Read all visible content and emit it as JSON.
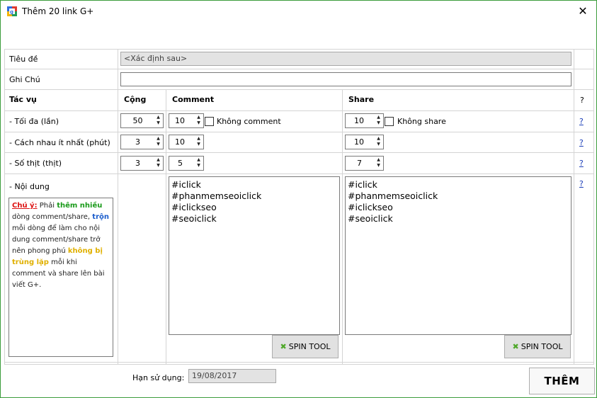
{
  "window": {
    "title": "Thêm 20 link G+",
    "close_glyph": "✕"
  },
  "rows": {
    "tieu_de": {
      "label": "Tiêu đề",
      "value": "<Xác định sau>"
    },
    "ghi_chu": {
      "label": "Ghi Chú",
      "value": ""
    }
  },
  "headers": {
    "tac_vu": "Tác vụ",
    "cong": "Cộng",
    "comment": "Comment",
    "share": "Share",
    "help": "?"
  },
  "toi_da": {
    "label": " - Tối đa (lần)",
    "cong": "50",
    "comment": "10",
    "comment_check": "Không comment",
    "share": "10",
    "share_check": "Không share",
    "help": "?"
  },
  "cach_nhau": {
    "label": " - Cách nhau ít nhất (phút)",
    "cong": "3",
    "comment": "10",
    "share": "10",
    "help": "?"
  },
  "so_thit": {
    "label": " - Số thịt (thịt)",
    "cong": "3",
    "comment": "5",
    "share": "7",
    "help": "?"
  },
  "noi_dung": {
    "label": " - Nội dung",
    "help": "?",
    "comment_lines": [
      "#iclick",
      "#phanmemseoiclick",
      "#iclickseo",
      "#seoiclick"
    ],
    "share_lines": [
      "#iclick",
      "#phanmemseoiclick",
      "#iclickseo",
      "#seoiclick"
    ]
  },
  "note": {
    "chu_y": "Chú ý:",
    "t1": " Phải ",
    "them_nhieu": "thêm nhiều",
    "t2": " dòng comment/share, ",
    "tron": "trộn",
    "t3": " mỗi dòng để làm cho nội dung comment/share trở nên phong phú ",
    "khong_bi": "không bị trùng lặp",
    "t4": " mỗi khi comment và share lên bài viết G+."
  },
  "spin_tool": {
    "label": "SPIN TOOL",
    "icon": "shuffle-icon"
  },
  "footer": {
    "han_label": "Hạn sử dụng:",
    "han_value": "19/08/2017",
    "them": "THÊM"
  },
  "colors": {
    "accent_green": "#1a9a1a",
    "link_blue": "#1a3db8",
    "warn_red": "#d11111",
    "border": "#3c9c3c"
  }
}
